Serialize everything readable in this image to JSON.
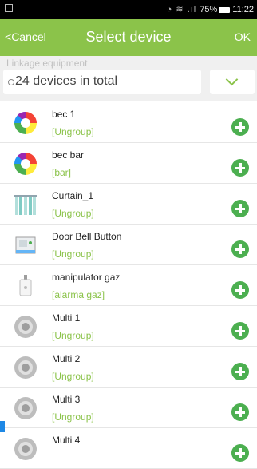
{
  "status_bar": {
    "battery": "75%",
    "time": "11:22"
  },
  "header": {
    "cancel_label": "Cancel",
    "title": "Select device",
    "ok_label": "OK"
  },
  "filter": {
    "label": "Linkage equipment",
    "count_text": "24 devices in total"
  },
  "colors": {
    "accent": "#8bc34a",
    "add_button": "#4caf50",
    "group_text": "#8bc34a"
  },
  "devices": [
    {
      "name": "bec 1",
      "group": "[Ungroup]",
      "icon": "color-bulb-icon"
    },
    {
      "name": "bec bar",
      "group": "[bar]",
      "icon": "color-bulb-icon"
    },
    {
      "name": "Curtain_1",
      "group": "[Ungroup]",
      "icon": "curtain-icon"
    },
    {
      "name": "Door Bell Button",
      "group": "[Ungroup]",
      "icon": "doorbell-icon"
    },
    {
      "name": "manipulator gaz",
      "group": "[alarma gaz]",
      "icon": "gas-valve-icon"
    },
    {
      "name": "Multi 1",
      "group": "[Ungroup]",
      "icon": "sensor-disc-icon"
    },
    {
      "name": "Multi 2",
      "group": "[Ungroup]",
      "icon": "sensor-disc-icon"
    },
    {
      "name": "Multi 3",
      "group": "[Ungroup]",
      "icon": "sensor-disc-icon"
    },
    {
      "name": "Multi 4",
      "group": "",
      "icon": "sensor-disc-icon"
    }
  ]
}
